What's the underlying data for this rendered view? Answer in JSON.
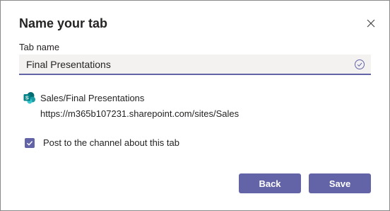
{
  "dialog": {
    "title": "Name your tab",
    "close_icon": "close-icon"
  },
  "tab_name": {
    "label": "Tab name",
    "value": "Final Presentations",
    "valid_icon": "check-circle-icon"
  },
  "source": {
    "icon": "sharepoint-icon",
    "name": "Sales/Final Presentations",
    "url": "https://m365b107231.sharepoint.com/sites/Sales"
  },
  "post_option": {
    "label": "Post to the channel about this tab",
    "checked": true
  },
  "buttons": {
    "back_label": "Back",
    "save_label": "Save"
  },
  "colors": {
    "accent": "#6264a7",
    "input_bg": "#f3f2f1",
    "sharepoint_teal": "#038387"
  }
}
